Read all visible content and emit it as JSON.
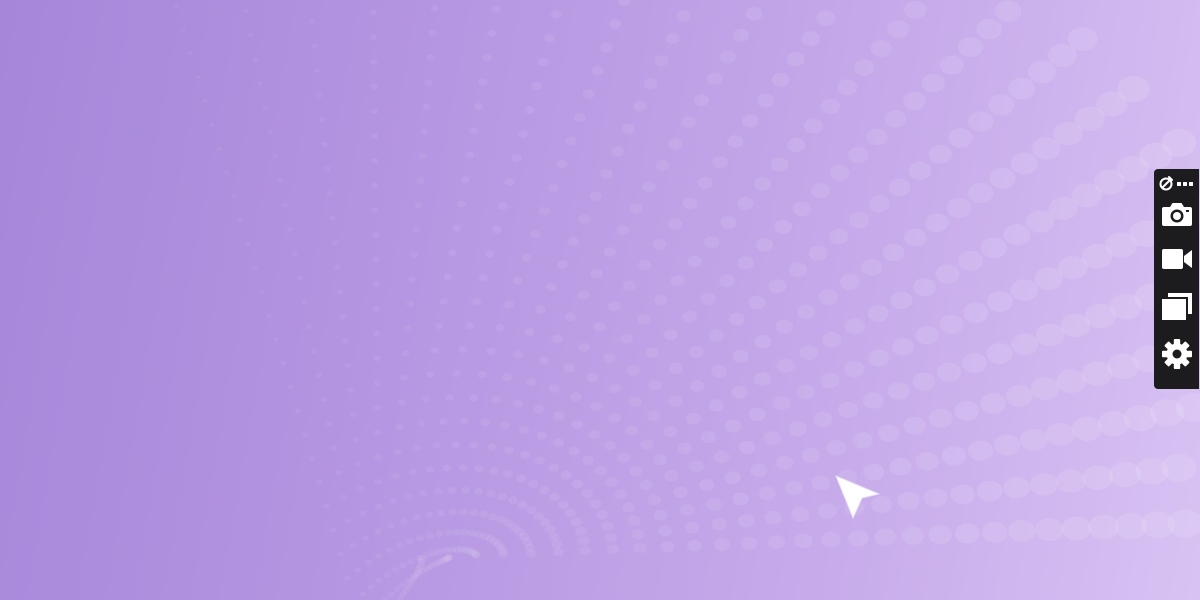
{
  "desktop": {
    "background_start": "#a586d9",
    "background_end": "#d8c2f3",
    "dot_color": "#ffffff"
  },
  "toolbar": {
    "background": "#1c1c1e",
    "icon_color": "#ffffff",
    "tools": [
      {
        "name": "link-more",
        "icon": "link-icon"
      },
      {
        "name": "screenshot",
        "icon": "camera-icon"
      },
      {
        "name": "record-video",
        "icon": "video-camera-icon"
      },
      {
        "name": "windows",
        "icon": "windows-stack-icon"
      },
      {
        "name": "settings",
        "icon": "gear-icon"
      }
    ]
  },
  "cursor": {
    "icon": "pointer-arrow-icon",
    "color": "#ffffff"
  }
}
